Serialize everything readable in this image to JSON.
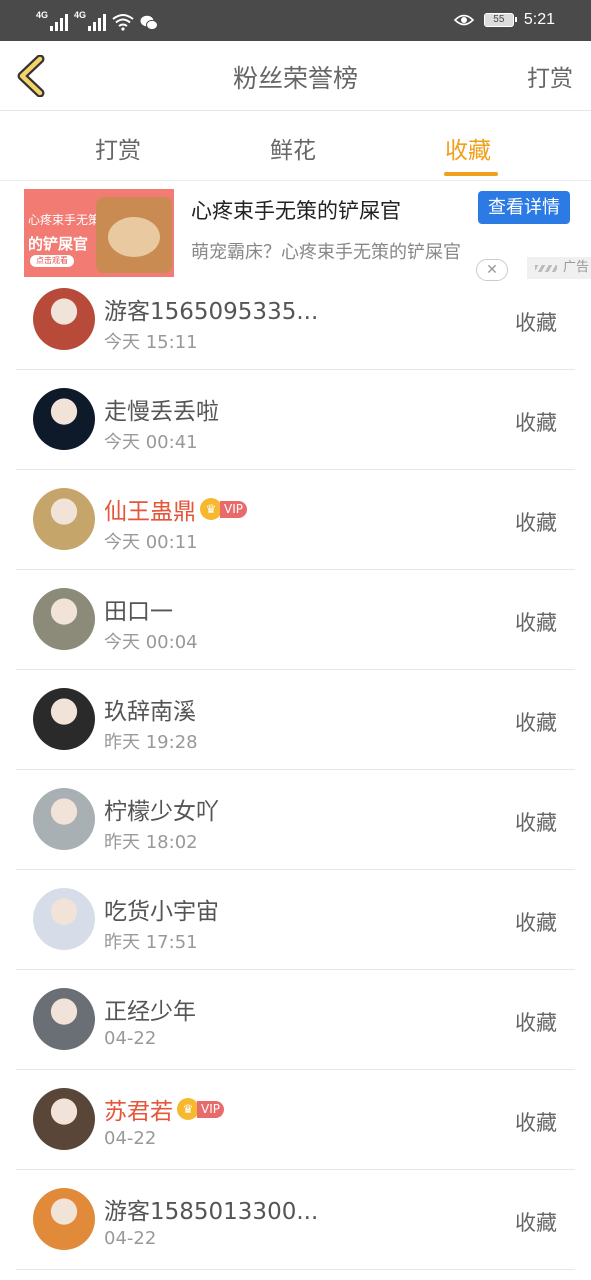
{
  "status_bar": {
    "network1": "4G",
    "network2": "4G",
    "battery": "55",
    "time": "5:21"
  },
  "header": {
    "title": "粉丝荣誉榜",
    "right_action": "打赏"
  },
  "tabs": [
    {
      "label": "打赏",
      "active": false
    },
    {
      "label": "鲜花",
      "active": false
    },
    {
      "label": "收藏",
      "active": true
    }
  ],
  "ad": {
    "image_line1": "心疼束手无策",
    "image_line2": "的铲屎官",
    "image_button": "点击观看",
    "title": "心疼束手无策的铲屎官",
    "description": "萌宠霸床？心疼束手无策的铲屎官",
    "cta": "查看详情",
    "label": "广告"
  },
  "colors": {
    "accent": "#f0a01a",
    "vip_name": "#e6553a",
    "ad_button": "#2c7be5"
  },
  "list": [
    {
      "name": "游客1565095335...",
      "time": "今天 15:11",
      "action": "收藏",
      "vip": false,
      "avatar_color": "#b84a3a"
    },
    {
      "name": "走慢丢丢啦",
      "time": "今天 00:41",
      "action": "收藏",
      "vip": false,
      "avatar_color": "#0e1a2a"
    },
    {
      "name": "仙王蛊鼎",
      "time": "今天 00:11",
      "action": "收藏",
      "vip": true,
      "vip_label": "VIP",
      "avatar_color": "#c6a56a"
    },
    {
      "name": "田口一",
      "time": "今天 00:04",
      "action": "收藏",
      "vip": false,
      "avatar_color": "#8c8a78"
    },
    {
      "name": "玖辞南溪",
      "time": "昨天 19:28",
      "action": "收藏",
      "vip": false,
      "avatar_color": "#2a2a2a"
    },
    {
      "name": "柠檬少女吖",
      "time": "昨天 18:02",
      "action": "收藏",
      "vip": false,
      "avatar_color": "#a9b0b4"
    },
    {
      "name": "吃货小宇宙",
      "time": "昨天 17:51",
      "action": "收藏",
      "vip": false,
      "avatar_color": "#d7dde8"
    },
    {
      "name": "正经少年",
      "time": "04-22",
      "action": "收藏",
      "vip": false,
      "avatar_color": "#6a6f75"
    },
    {
      "name": "苏君若",
      "time": "04-22",
      "action": "收藏",
      "vip": true,
      "vip_label": "VIP",
      "avatar_color": "#5a4638"
    },
    {
      "name": "游客1585013300...",
      "time": "04-22",
      "action": "收藏",
      "vip": false,
      "avatar_color": "#e08a3a"
    }
  ]
}
